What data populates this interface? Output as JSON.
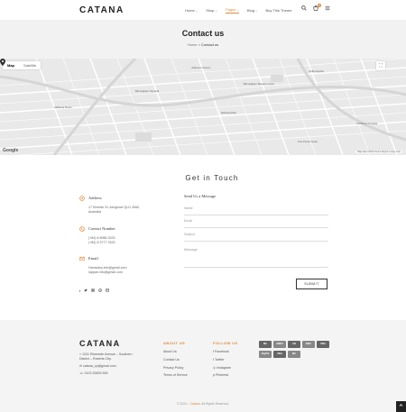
{
  "header": {
    "logo": "CATANA",
    "nav": [
      {
        "label": "Home",
        "chevron": "⌄"
      },
      {
        "label": "Shop",
        "chevron": "⌄"
      },
      {
        "label": "Pages",
        "chevron": "⌄"
      },
      {
        "label": "Blog",
        "chevron": "⌄"
      },
      {
        "label": "Buy This Theme",
        "chevron": ""
      }
    ],
    "cart_count": "0"
  },
  "title_band": {
    "title": "Contact us",
    "crumb_home": "Home",
    "crumb_sep": "»",
    "crumb_current": "Contact us"
  },
  "map": {
    "tab_map": "Map",
    "tab_satellite": "Satellite",
    "google": "Google",
    "attribution": "Map data ©2024   Terms   Report a map error",
    "labels": [
      "Jefferson Towers",
      "UAB Hospital",
      "Birmingham City Hall",
      "Railroad Park",
      "Birmingham Museum of Art",
      "Children's Hospital",
      "Alabama Power",
      "Five Points South"
    ]
  },
  "contact": {
    "heading": "Get in Touch",
    "address": {
      "title": "Address",
      "lines": [
        "17 Elmede St. Ashgrove QLD 4060,",
        "Australia"
      ]
    },
    "phone": {
      "title": "Contact Number",
      "lines": [
        "(+84) 8 8986 3333",
        "(+84) 8 3777 3333"
      ]
    },
    "email": {
      "title": "Email",
      "lines": [
        "Hamsoley.info@gmail.com",
        "Iappan.info@gmail.com"
      ]
    },
    "form": {
      "title": "Send Us a Message",
      "name_ph": "Name",
      "email_ph": "Email",
      "subject_ph": "Subject",
      "message_ph": "Message",
      "submit": "SUBMIT"
    }
  },
  "footer": {
    "logo": "CATANA",
    "address_lines": [
      "1241 Riverside Avenue – Southern",
      "District – Roberts City."
    ],
    "email": "catana_vp@gmail.com",
    "phone": "0123 25453 545",
    "about_head": "ABOUT US",
    "about_links": [
      "About Us",
      "Contact Us",
      "Privacy Policy",
      "Terms of Service"
    ],
    "follow_head": "FOLLOW US",
    "follow_links": [
      "Facebook",
      "Twitter",
      "Instagram",
      "Pinterest"
    ],
    "payments": [
      "MC",
      "AMEX",
      "CB",
      "DISC",
      "VISA",
      "PayPal",
      "VISA",
      "MC"
    ],
    "copyright_pre": "© 2024 –",
    "copyright_brand": "Catana",
    "copyright_post": ". All Rights Reserved."
  }
}
